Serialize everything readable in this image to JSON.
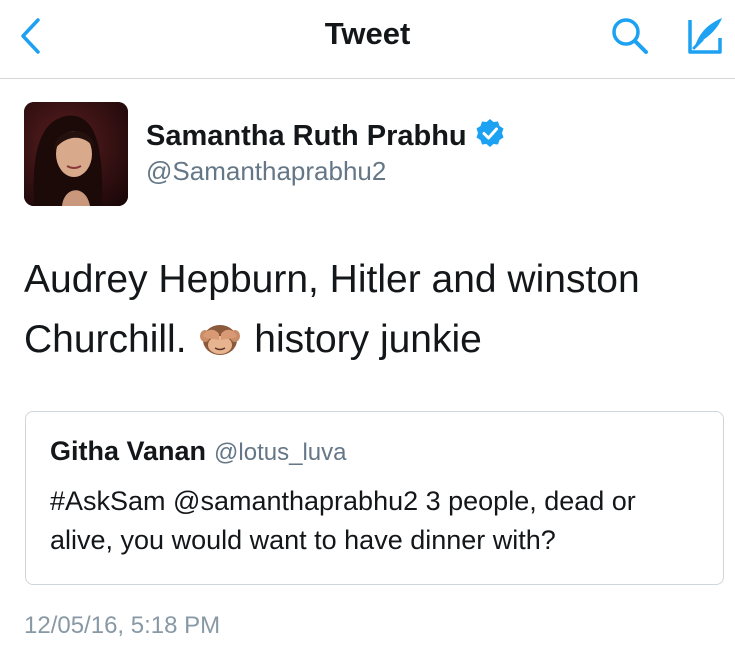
{
  "navbar": {
    "title": "Tweet",
    "back_icon": "chevron-left-icon",
    "search_icon": "search-icon",
    "compose_icon": "compose-quill-icon",
    "accent_color": "#1da1f2"
  },
  "tweet": {
    "author_name": "Samantha Ruth Prabhu",
    "author_handle": "@Samanthaprabhu2",
    "verified": true,
    "text_before_emoji": "Audrey Hepburn, Hitler and winston Churchill.",
    "emoji": "see-no-evil-monkey-icon",
    "text_after_emoji": "history junkie",
    "timestamp": "12/05/16, 5:18 PM"
  },
  "quoted_tweet": {
    "author_name": "Githa Vanan",
    "author_handle": "@lotus_luva",
    "text": "#AskSam @samanthaprabhu2 3 people, dead or alive, you would want to have dinner with?"
  },
  "colors": {
    "text_primary": "#14171a",
    "text_secondary": "#657786",
    "timestamp": "#8899a6",
    "border": "#cfd6db"
  }
}
